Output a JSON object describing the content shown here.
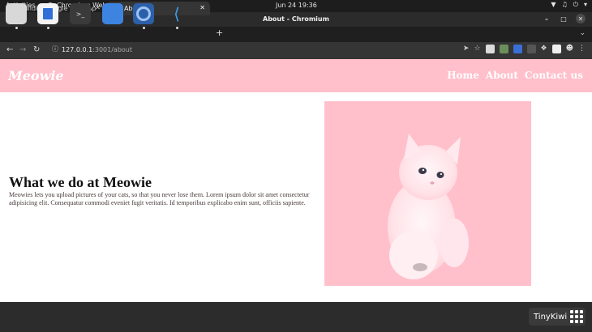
{
  "system_bar": {
    "activities": "Activities",
    "app_name": "Chromium Web Browser",
    "clock": "Jun 24  19:36"
  },
  "window": {
    "title": "About - Chromium"
  },
  "tabs": [
    {
      "label": "Building Single Page App",
      "active": false
    },
    {
      "label": "About",
      "active": true
    }
  ],
  "omnibox": {
    "host": "127.0.0.1",
    "port_path": ":3001/about"
  },
  "site": {
    "brand": "Meowie",
    "nav": [
      "Home",
      "About",
      "Contact us"
    ],
    "heading": "What we do at Meowie",
    "body": "Meowies lets you upload pictures of your cats, so that you never lose them. Lorem ipsum dolor sit amet consectetur adipisicing elit. Consequatur commodi eveniet fugit veritatis. Id temporibus explicabo enim sunt, officiis sapiente."
  },
  "dock": {
    "overlay_label": "TinyKiwi"
  },
  "colors": {
    "nav_bg": "#ffc0cb",
    "photo_bg": "#ffc0cb",
    "chrome_dark": "#353535"
  }
}
